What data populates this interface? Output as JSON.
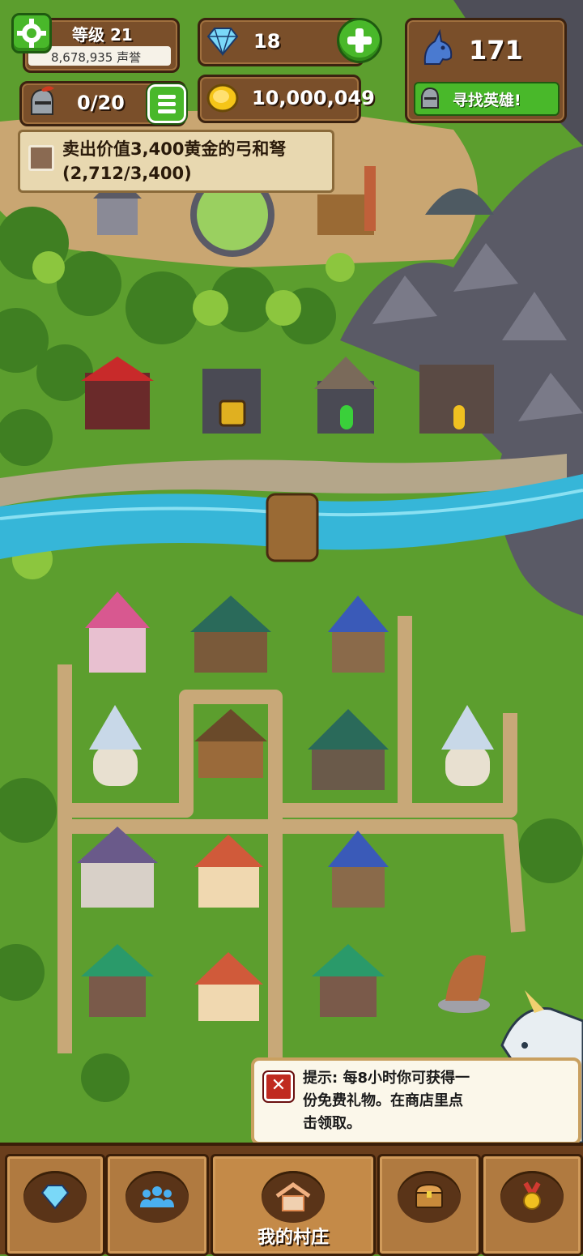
{
  "hud": {
    "level_label": "等级 21",
    "reputation": "8,678,935 声誉",
    "heroes": "0/20",
    "gems": "18",
    "gold": "10,000,049",
    "unicorns": "171",
    "find_heroes_label": "寻找英雄!"
  },
  "quest": {
    "title": "卖出价值3,400黄金的弓和弩",
    "progress": "(2,712/3,400)",
    "progress_fraction": 0.798
  },
  "tip": {
    "text_line1": "提示: 每8小时你可获得一",
    "text_line2": "份免费礼物。在商店里点",
    "text_line3": "击领取。"
  },
  "nav": {
    "items": [
      {
        "icon": "gem-icon",
        "label": ""
      },
      {
        "icon": "people-icon",
        "label": ""
      },
      {
        "icon": "house-icon",
        "label": "我的村庄"
      },
      {
        "icon": "chest-icon",
        "label": ""
      },
      {
        "icon": "medal-icon",
        "label": ""
      }
    ]
  },
  "colors": {
    "grass": "#5a9a2e",
    "river": "#36b6d8",
    "panel_wood": "#7a4f2a",
    "accent_green": "#49b82a"
  }
}
